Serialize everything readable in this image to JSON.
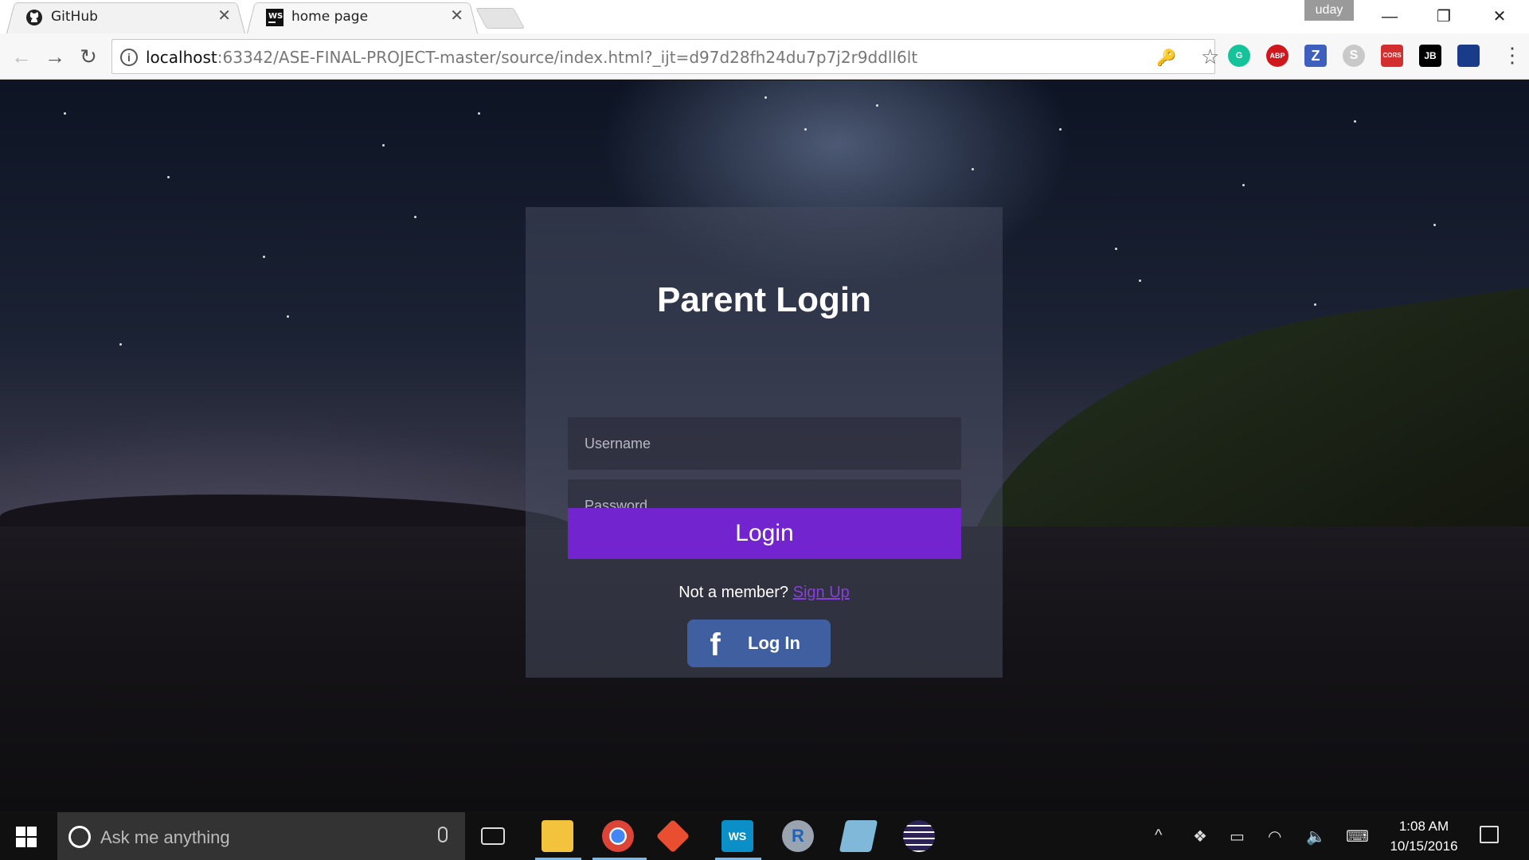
{
  "browser": {
    "tabs": [
      {
        "title": "GitHub",
        "favicon": "github-icon",
        "active": false
      },
      {
        "title": "home page",
        "favicon": "webstorm-icon",
        "active": true
      }
    ],
    "profile_name": "uday",
    "address": {
      "host": "localhost",
      "rest": ":63342/ASE-FINAL-PROJECT-master/source/index.html?_ijt=d97d28fh24du7p7j2r9ddll6lt"
    },
    "extensions": [
      {
        "name": "grammarly-icon",
        "label": "G",
        "color": "#15c39a"
      },
      {
        "name": "adblock-plus-icon",
        "label": "ABP",
        "color": "#d1171e"
      },
      {
        "name": "zotero-icon",
        "label": "Z",
        "color": "#3f5fbf"
      },
      {
        "name": "skype-icon",
        "label": "S",
        "color": "#9e9e9e"
      },
      {
        "name": "cors-icon",
        "label": "CORS",
        "color": "#d32f2f"
      },
      {
        "name": "jetbrains-icon",
        "label": "JB",
        "color": "#000000"
      },
      {
        "name": "flag-icon",
        "label": "",
        "color": "#1a3a8a"
      }
    ]
  },
  "login": {
    "title": "Parent Login",
    "username_placeholder": "Username",
    "password_placeholder": "Password",
    "login_button": "Login",
    "member_text": "Not a member?",
    "signup_link": "Sign Up",
    "facebook_button": "Log In",
    "accent_color": "#7225cf",
    "facebook_color": "#3f5fa0"
  },
  "taskbar": {
    "search_placeholder": "Ask me anything",
    "apps": [
      {
        "name": "file-explorer-icon",
        "label": "",
        "color": "#f3c33d"
      },
      {
        "name": "chrome-icon",
        "label": "",
        "color": "#4285f4"
      },
      {
        "name": "git-icon",
        "label": "",
        "color": "#e94e31"
      },
      {
        "name": "webstorm-icon",
        "label": "WS",
        "color": "#0a8fc9"
      },
      {
        "name": "r-icon",
        "label": "R",
        "color": "#1e63b5"
      },
      {
        "name": "notes-icon",
        "label": "",
        "color": "#7fb8d8"
      },
      {
        "name": "eclipse-icon",
        "label": "",
        "color": "#2c2255"
      }
    ],
    "time": "1:08 AM",
    "date": "10/15/2016"
  }
}
